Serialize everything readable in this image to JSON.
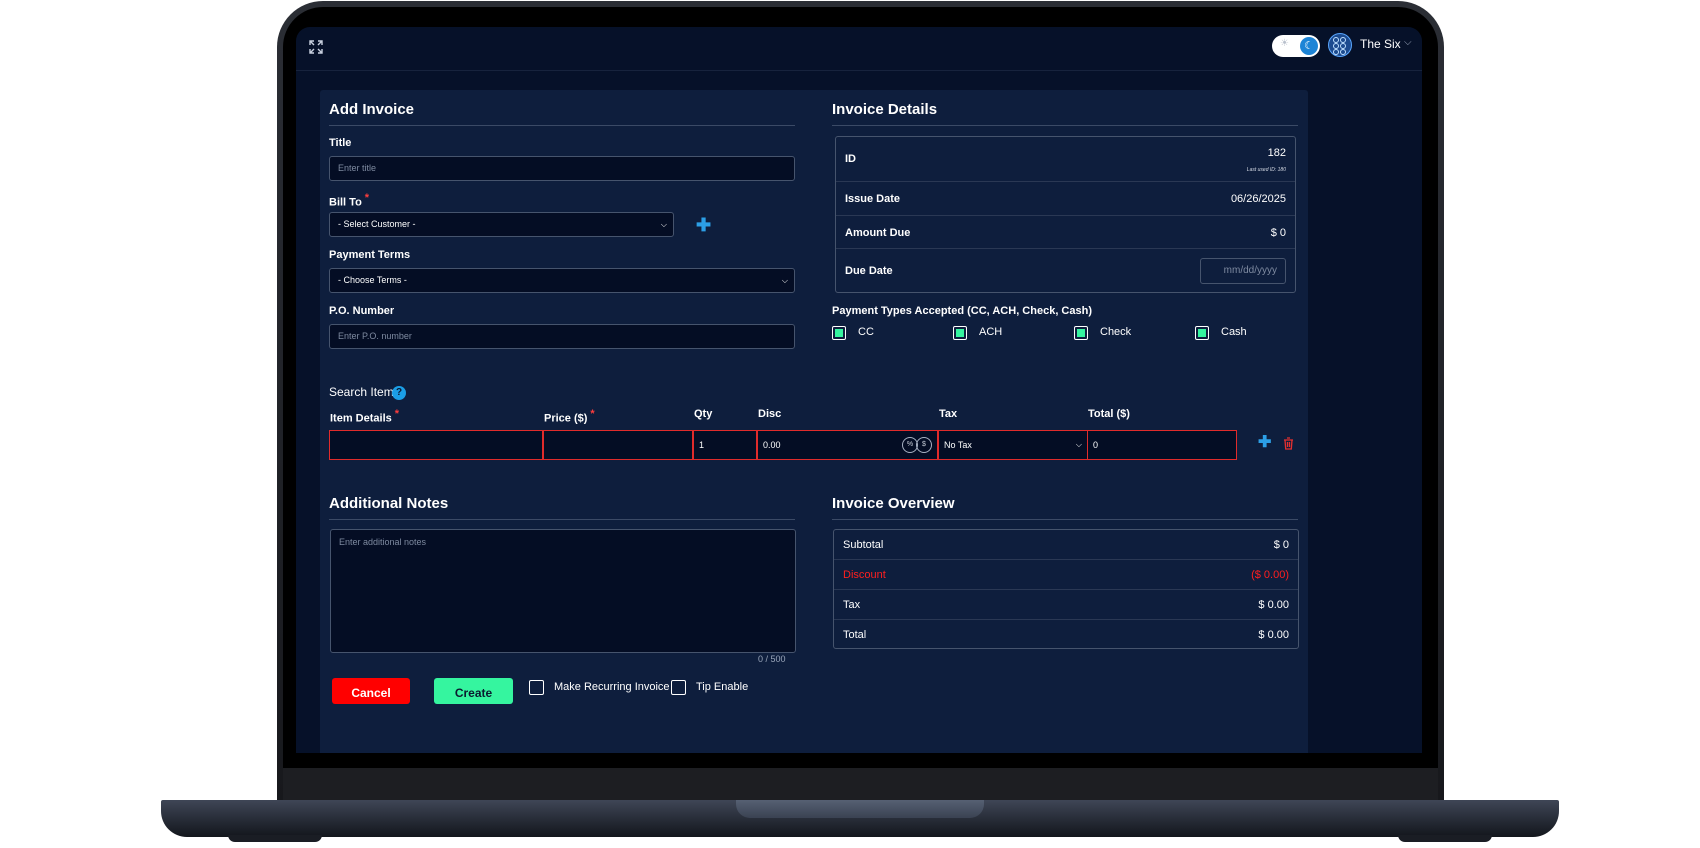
{
  "app": {
    "org_name": "The Six"
  },
  "add_invoice": {
    "title": "Add Invoice",
    "title_label": "Title",
    "title_placeholder": "Enter title",
    "bill_to_label": "Bill To",
    "bill_to_value": "- Select Customer -",
    "payment_terms_label": "Payment Terms",
    "payment_terms_value": "- Choose Terms -",
    "po_label": "P.O. Number",
    "po_placeholder": "Enter P.O. number"
  },
  "invoice_details": {
    "title": "Invoice Details",
    "id_label": "ID",
    "id_value": "182",
    "last_used": "Last used ID: 180",
    "issue_date_label": "Issue Date",
    "issue_date_value": "06/26/2025",
    "amount_due_label": "Amount Due",
    "amount_due_value": "$ 0",
    "due_date_label": "Due Date",
    "due_date_placeholder": "mm/dd/yyyy"
  },
  "payment_types": {
    "label": "Payment Types Accepted (CC, ACH, Check, Cash)",
    "options": [
      {
        "label": "CC",
        "checked": true
      },
      {
        "label": "ACH",
        "checked": true
      },
      {
        "label": "Check",
        "checked": true
      },
      {
        "label": "Cash",
        "checked": true
      }
    ]
  },
  "items": {
    "search_label": "Search Item",
    "help_glyph": "?",
    "columns": {
      "item_details": "Item Details",
      "price": "Price ($)",
      "qty": "Qty",
      "disc": "Disc",
      "tax": "Tax",
      "total": "Total ($)"
    },
    "row": {
      "item_details": "",
      "price": "",
      "qty": "1",
      "disc": "0.00",
      "disc_percent": "%",
      "disc_dollar": "$",
      "tax": "No Tax",
      "total": "0"
    }
  },
  "notes": {
    "title": "Additional Notes",
    "placeholder": "Enter additional notes",
    "char_count": "0 / 500"
  },
  "overview": {
    "title": "Invoice Overview",
    "rows": [
      {
        "label": "Subtotal",
        "value": "$ 0"
      },
      {
        "label": "Discount",
        "value": "($ 0.00)"
      },
      {
        "label": "Tax",
        "value": "$ 0.00"
      },
      {
        "label": "Total",
        "value": "$ 0.00"
      }
    ]
  },
  "actions": {
    "cancel_label": "Cancel",
    "create_label": "Create",
    "recurring_label": "Make Recurring Invoice",
    "tip_label": "Tip Enable"
  },
  "colors": {
    "background": "#061129",
    "panel": "#0e1e3d",
    "accent_blue": "#2c9fe6",
    "accent_green": "#35f59f",
    "danger": "#ff0000"
  },
  "icons": [
    "expand-icon",
    "sun-icon",
    "moon-icon",
    "org-logo-icon",
    "chevron-down-icon",
    "plus-icon",
    "help-icon",
    "trash-icon"
  ]
}
